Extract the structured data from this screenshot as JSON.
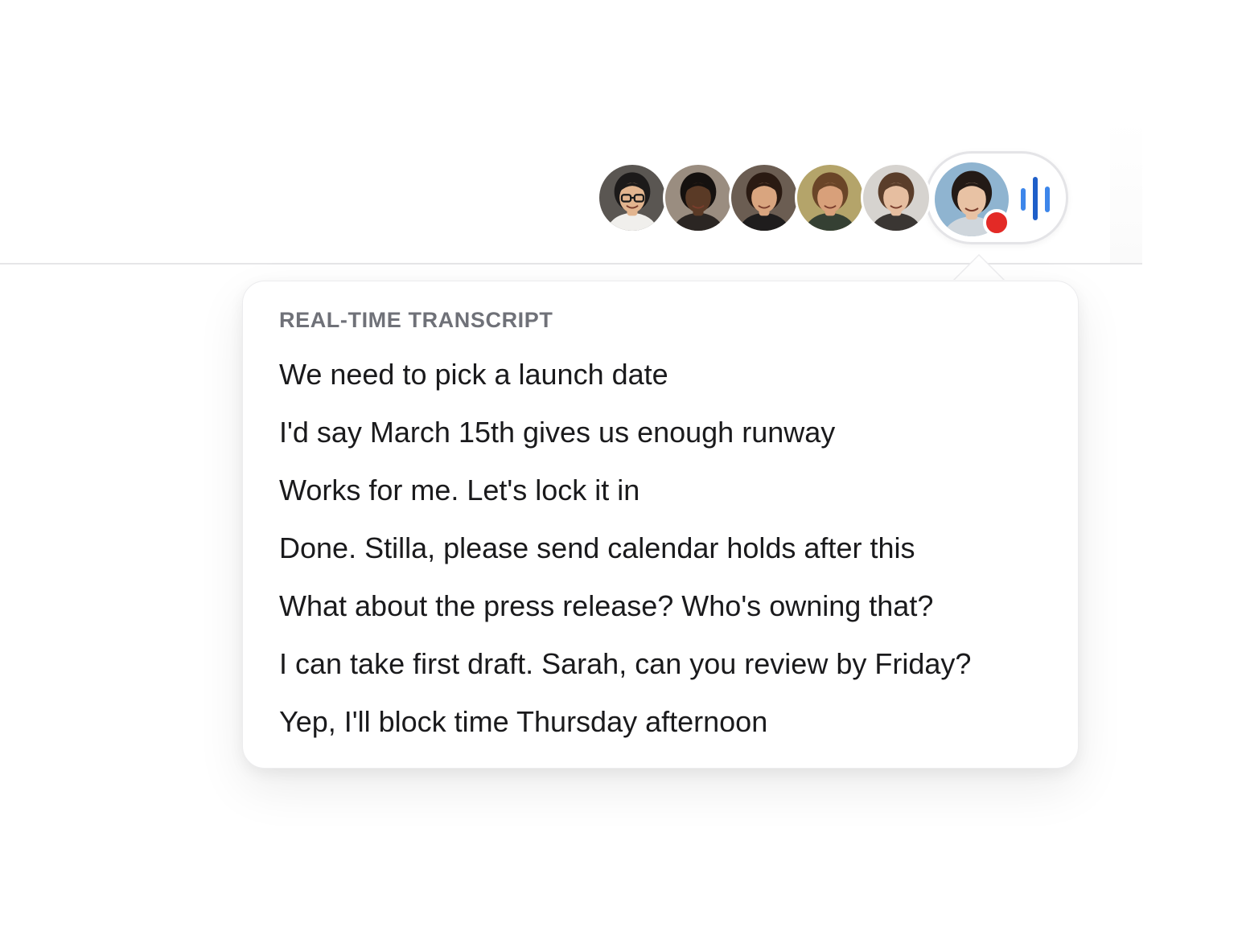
{
  "participants": [
    {
      "name": "participant-1",
      "skin": "#e2b58f",
      "hair": "#1c1a1a",
      "bg": "#5a5652",
      "shirt": "#f0efec",
      "glasses": true
    },
    {
      "name": "participant-2",
      "skin": "#5a3a26",
      "hair": "#15110f",
      "bg": "#9a8d80",
      "shirt": "#2b2623"
    },
    {
      "name": "participant-3",
      "skin": "#d9a57f",
      "hair": "#2a1a12",
      "bg": "#6b5d52",
      "shirt": "#1f1d1d"
    },
    {
      "name": "participant-4",
      "skin": "#d8a07a",
      "hair": "#6a4528",
      "bg": "#b4a46a",
      "shirt": "#354033"
    },
    {
      "name": "participant-5",
      "skin": "#e6bea0",
      "hair": "#5a3d2a",
      "bg": "#d6d3cf",
      "shirt": "#3a3633"
    }
  ],
  "active_speaker": {
    "skin": "#e8c2a4",
    "hair": "#231a16",
    "bg": "#8fb4d0",
    "shirt": "#cfd6dc",
    "recording": true
  },
  "colors": {
    "recording_dot": "#e32a26",
    "audio_bar_dark": "#1f5fc9",
    "audio_bar_light": "#3d86ea"
  },
  "transcript": {
    "title": "REAL-TIME TRANSCRIPT",
    "lines": [
      "We need to pick a launch date",
      "I'd say March 15th gives us enough runway",
      "Works for me. Let's lock it in",
      "Done. Stilla, please send calendar holds after this",
      "What about the press release? Who's owning that?",
      "I can take first draft. Sarah, can you review by Friday?",
      "Yep, I'll block time Thursday afternoon"
    ]
  }
}
